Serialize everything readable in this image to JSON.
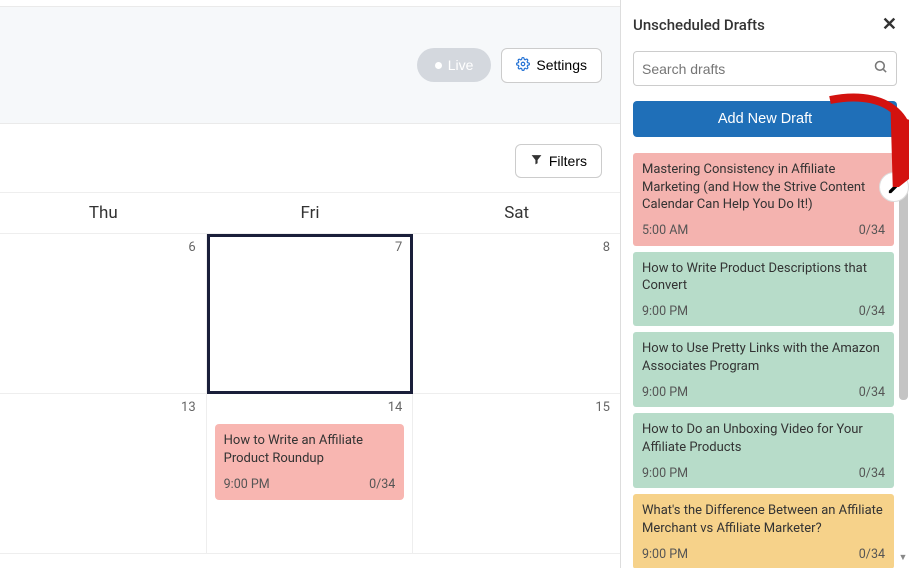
{
  "toolbar": {
    "live_label": "Live",
    "settings_label": "Settings",
    "filters_label": "Filters"
  },
  "calendar": {
    "day_headers": [
      "Thu",
      "Fri",
      "Sat"
    ],
    "cells": [
      {
        "num": "6"
      },
      {
        "num": "7",
        "selected": true
      },
      {
        "num": "8"
      },
      {
        "num": "13"
      },
      {
        "num": "14",
        "event": {
          "title": "How to Write an Affiliate Product Roundup",
          "time": "9:00 PM",
          "count": "0/34",
          "color": "pink"
        }
      },
      {
        "num": "15"
      }
    ]
  },
  "sidebar": {
    "title": "Unscheduled Drafts",
    "search_placeholder": "Search drafts",
    "add_label": "Add New Draft",
    "drafts": [
      {
        "title": "Mastering Consistency in Affiliate Marketing (and How the Strive Content Calendar Can Help You Do It!)",
        "time": "5:00 AM",
        "count": "0/34",
        "color": "pink"
      },
      {
        "title": "How to Write Product Descriptions that Convert",
        "time": "9:00 PM",
        "count": "0/34",
        "color": "green"
      },
      {
        "title": "How to Use Pretty Links with the Amazon Associates Program",
        "time": "9:00 PM",
        "count": "0/34",
        "color": "green"
      },
      {
        "title": "How to Do an Unboxing Video for Your Affiliate Products",
        "time": "9:00 PM",
        "count": "0/34",
        "color": "green"
      },
      {
        "title": "What's the Difference Between an Affiliate Merchant vs Affiliate Marketer?",
        "time": "9:00 PM",
        "count": "0/34",
        "color": "yellow"
      }
    ]
  },
  "colors": {
    "pink": "#f4b3af",
    "green": "#b7dcc9",
    "yellow": "#f6d28a",
    "blue": "#1f6fb8"
  }
}
